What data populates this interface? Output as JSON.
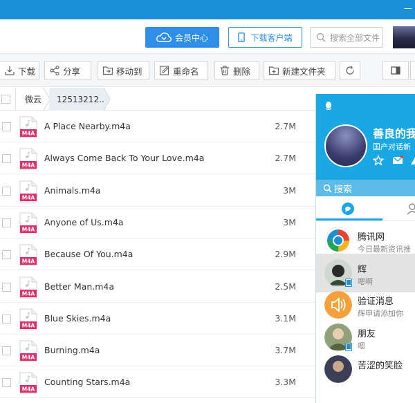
{
  "header": {
    "vip_label": "会员中心",
    "download_client_label": "下载客户端",
    "search_placeholder": "搜索全部文件"
  },
  "toolbar": {
    "download": "下载",
    "share": "分享",
    "move_to": "移动到",
    "rename": "重命名",
    "delete": "删除",
    "new_folder": "新建文件夹"
  },
  "breadcrumb": {
    "root": "微云",
    "current": "12513212.."
  },
  "file_icon_label": "M4A",
  "files": [
    {
      "name": "A Place Nearby.m4a",
      "size": "2.7M"
    },
    {
      "name": "Always Come Back To Your Love.m4a",
      "size": "2.7M"
    },
    {
      "name": "Animals.m4a",
      "size": "3M"
    },
    {
      "name": "Anyone of Us.m4a",
      "size": "3M"
    },
    {
      "name": "Because Of You.m4a",
      "size": "2.9M"
    },
    {
      "name": "Better Man.m4a",
      "size": "2.5M"
    },
    {
      "name": "Blue Skies.m4a",
      "size": "3.1M"
    },
    {
      "name": "Burning.m4a",
      "size": "3.7M"
    },
    {
      "name": "Counting Stars.m4a",
      "size": "3.3M"
    }
  ],
  "qq": {
    "nickname": "善良的我",
    "signature": "国产对话新",
    "search_label": "搜索",
    "conversations": [
      {
        "name": "腾讯网",
        "message": "今日最新资讯推",
        "active": false
      },
      {
        "name": "辉",
        "message": "嗯啊",
        "active": true
      },
      {
        "name": "验证消息",
        "message": "辉申请添加你",
        "active": false
      },
      {
        "name": "朋友",
        "message": "嗯",
        "active": false
      },
      {
        "name": "苦涩的笑脸",
        "message": "",
        "active": false
      }
    ]
  },
  "colors": {
    "brand_blue": "#1a8fd8",
    "vip_blue": "#2e8ee8",
    "qq_blue": "#1aa8e5",
    "m4a_pink": "#e0306a"
  }
}
